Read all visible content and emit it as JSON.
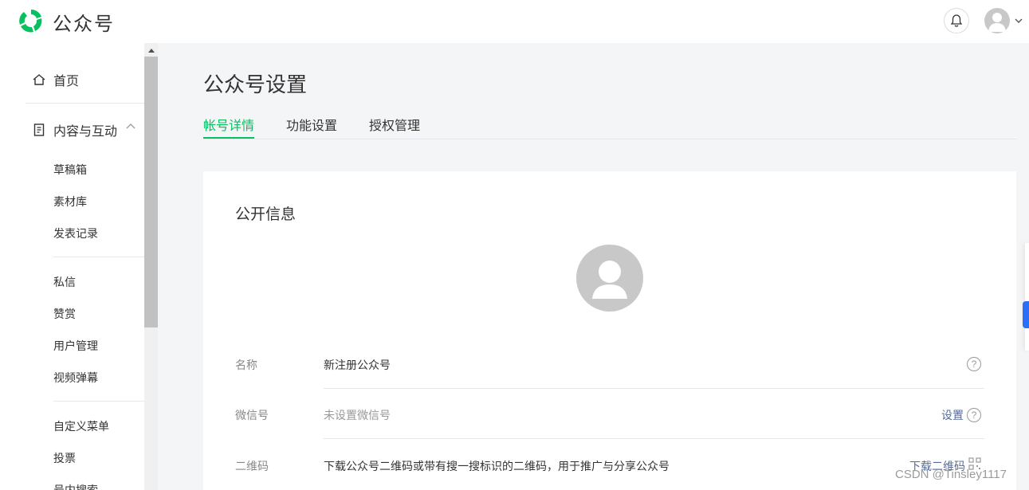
{
  "header": {
    "brand": "公众号"
  },
  "sidebar": {
    "home": "首页",
    "content_group": "内容与互动",
    "items": [
      "草稿箱",
      "素材库",
      "发表记录",
      "私信",
      "赞赏",
      "用户管理",
      "视频弹幕",
      "自定义菜单",
      "投票",
      "号内搜索"
    ]
  },
  "main": {
    "page_title": "公众号设置",
    "tabs": [
      "帐号详情",
      "功能设置",
      "授权管理"
    ],
    "card_title": "公开信息",
    "rows": [
      {
        "label": "名称",
        "value": "新注册公众号"
      },
      {
        "label": "微信号",
        "value": "未设置微信号",
        "action": "设置"
      },
      {
        "label": "二维码",
        "value": "下载公众号二维码或带有搜一搜标识的二维码，用于推广与分享公众号",
        "action": "下载二维码"
      }
    ],
    "help_glyph": "?"
  },
  "watermark": "CSDN @Tinsley1117",
  "colors": {
    "accent": "#07c160",
    "link": "#576b95",
    "background": "#f4f5f7"
  }
}
